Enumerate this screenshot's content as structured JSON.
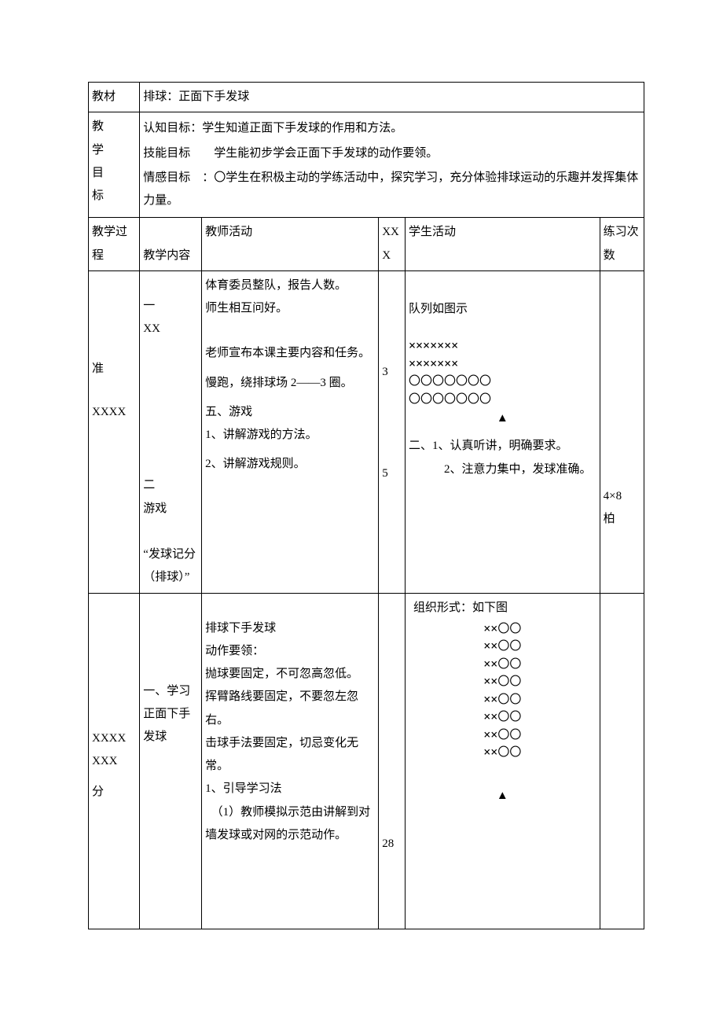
{
  "row1": {
    "label": "教材",
    "content": "排球：正面下手发球"
  },
  "row2": {
    "label_lines": [
      "教",
      "学",
      "目",
      "标"
    ],
    "goal1": "认知目标：学生知道正面下手发球的作用和方法。",
    "goal2": "技能目标　　学生能初步学会正面下手发球的动作要领。",
    "goal3": "情感目标　：〇学生在积极主动的学练活动中，探究学习，充分体验排球运动的乐趣并发挥集体力量。"
  },
  "header": {
    "c0a": "教学过",
    "c0b": "程",
    "c1": "教学内容",
    "c2": "教师活动",
    "c3a": "XX",
    "c3b": "X",
    "c4": "学生活动",
    "c5a": "练习次",
    "c5b": "数"
  },
  "prep": {
    "stage_l1": "准",
    "stage_l2": "XXXX",
    "content_block1": "一\nXX",
    "content_block2": "二\n游戏\n\n“发球记分（排球）”",
    "teacher_l1": "体育委员整队，报告人数。",
    "teacher_l2": "师生相互问好。",
    "teacher_l3": "老师宣布本课主要内容和任务。",
    "teacher_l4": "慢跑，绕排球场 2——3 圈。",
    "teacher_l5": "五、游戏",
    "teacher_l6": "1、讲解游戏的方法。",
    "teacher_l7": "2、讲解游戏规则。",
    "time1": "3",
    "time2": "5",
    "student_l1": "队列如图示",
    "student_f1": "×××××××",
    "student_f2": "×××××××",
    "student_f3": "〇〇〇〇〇〇〇",
    "student_f4": "〇〇〇〇〇〇〇",
    "student_tri": "▲",
    "student_l2": "二、1、认真听讲，明确要求。",
    "student_l3": "　　　2、注意力集中，发球准确。",
    "reps": "4×8\n柏"
  },
  "main": {
    "stage_l1": "XXXX",
    "stage_l2": "XXX",
    "stage_l3": "分",
    "content": "一、学习正面下手发球",
    "teacher_l1": "排球下手发球",
    "teacher_l2": "动作要领：",
    "teacher_l3": "抛球要固定，不可忽高忽低。",
    "teacher_l4": "挥臂路线要固定，不要忽左忽右。",
    "teacher_l5": "击球手法要固定，切忌变化无常。",
    "teacher_l6": "1、引导学习法",
    "teacher_l7": "　（1）教师模拟示范由讲解到对墙发球或对网的示范动作。",
    "time": "28",
    "student_head": "组织形式：如下图",
    "student_row": "××〇〇",
    "student_tri": "▲"
  }
}
